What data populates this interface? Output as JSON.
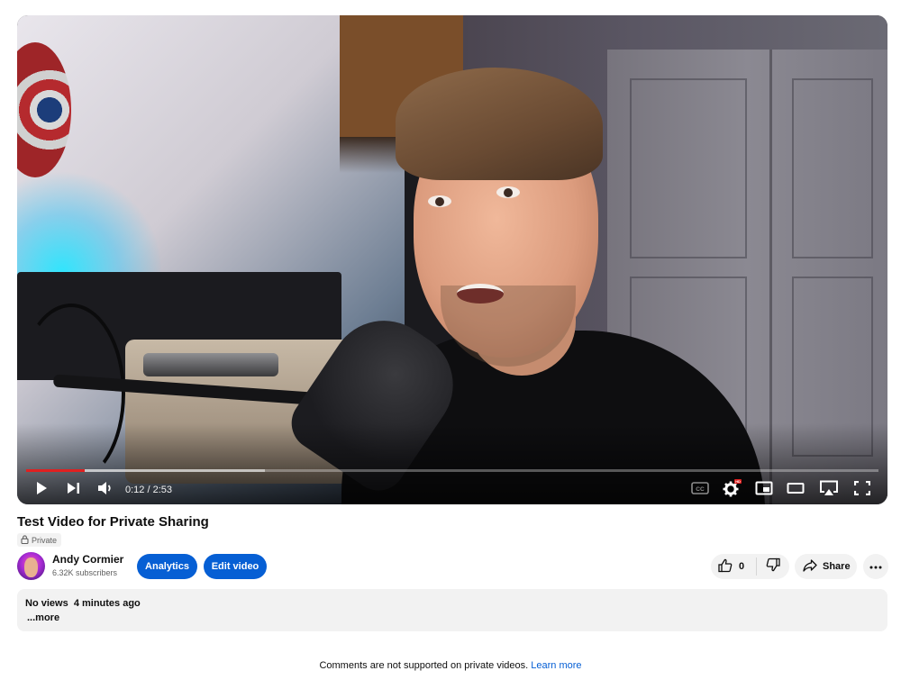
{
  "colors": {
    "accent": "#065fd4",
    "progress_played": "#e02020",
    "chip_bg": "#f2f2f2"
  },
  "player": {
    "progress_fraction": 0.069,
    "buffer_fraction": 0.28,
    "time_display": "0:12 / 2:53",
    "controls": {
      "play_icon": "play-icon",
      "next_icon": "next-icon",
      "volume_icon": "volume-icon",
      "captions_icon": "captions-icon",
      "captions_label": "CC",
      "settings_icon": "gear-icon",
      "settings_badge": "HD",
      "miniplayer_icon": "miniplayer-icon",
      "theater_icon": "theater-icon",
      "airplay_icon": "airplay-icon",
      "fullscreen_icon": "fullscreen-icon"
    }
  },
  "video": {
    "title": "Test Video for Private Sharing",
    "privacy": "Private",
    "privacy_icon": "lock-icon"
  },
  "channel": {
    "name": "Andy Cormier",
    "subscribers": "6.32K subscribers",
    "avatar_icon": "avatar"
  },
  "actions": {
    "analytics_label": "Analytics",
    "edit_label": "Edit video",
    "like_count": "0",
    "like_icon": "thumbs-up-icon",
    "dislike_icon": "thumbs-down-icon",
    "share_label": "Share",
    "share_icon": "share-icon",
    "more_icon": "more-icon"
  },
  "description": {
    "views": "No views",
    "uploaded": "4 minutes ago",
    "more_label": "...more"
  },
  "comments": {
    "note": "Comments are not supported on private videos.",
    "learn_more": "Learn more"
  }
}
